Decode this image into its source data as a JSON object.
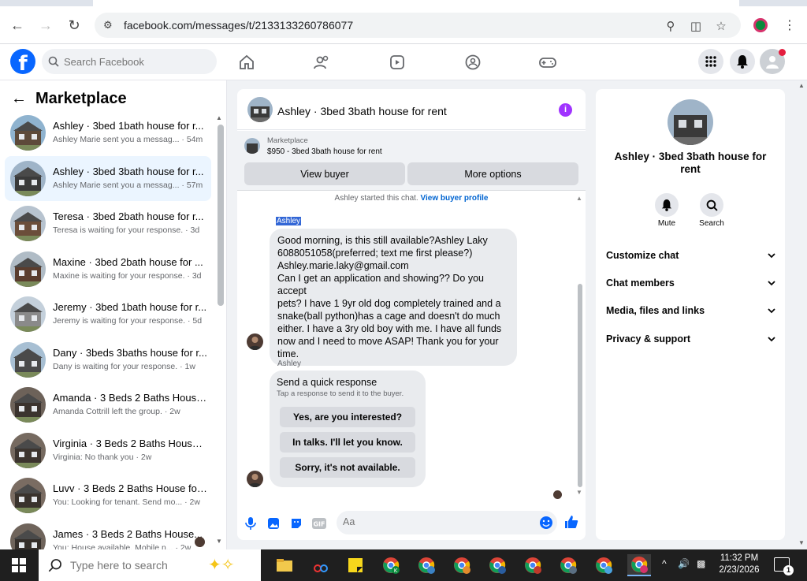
{
  "browser": {
    "url": "facebook.com/messages/t/2133133260786077"
  },
  "fb": {
    "search_placeholder": "Search Facebook",
    "logo": "f"
  },
  "left": {
    "title": "Marketplace",
    "conversations": [
      {
        "title": "Ashley · 3bed 1bath house for r...",
        "sub": "Ashley Marie sent you a messag... · 54m",
        "active": false
      },
      {
        "title": "Ashley · 3bed 3bath house for r...",
        "sub": "Ashley Marie sent you a messag... · 57m",
        "active": true
      },
      {
        "title": "Teresa · 3bed 2bath house for r...",
        "sub": "Teresa is waiting for your response. · 3d",
        "active": false
      },
      {
        "title": "Maxine · 3bed 2bath house for ...",
        "sub": "Maxine is waiting for your response. · 3d",
        "active": false
      },
      {
        "title": "Jeremy · 3bed 1bath house for r...",
        "sub": "Jeremy is waiting for your response. · 5d",
        "active": false
      },
      {
        "title": "Dany · 3beds 3baths house for r...",
        "sub": "Dany is waiting for your response. · 1w",
        "active": false
      },
      {
        "title": "Amanda · 3 Beds 2 Baths House...",
        "sub": "Amanda Cottrill left the group. · 2w",
        "active": false
      },
      {
        "title": "Virginia · 3 Beds 2 Baths House ...",
        "sub": "Virginia: No thank you · 2w",
        "active": false
      },
      {
        "title": "Luvv · 3 Beds 2 Baths House for...",
        "sub": "You: Looking for tenant. Send mo... · 2w",
        "active": false
      },
      {
        "title": "James · 3 Beds 2 Baths House...",
        "sub": "You: House available. Mobile n... · 2w",
        "active": false
      }
    ]
  },
  "chat": {
    "title": "Ashley · 3bed 3bath house for rent",
    "marketplace_label": "Marketplace",
    "listing": "$950 - 3bed 3bath house for rent",
    "view_buyer": "View buyer",
    "more_options": "More options",
    "notice": "Ashley started this chat.",
    "notice_link": "View buyer profile",
    "sender1": "Ashley",
    "message_lines": [
      "Good morning, is this still available?Ashley Laky",
      "6088051058(preferred; text me first please?)",
      "Ashley.marie.laky@gmail.com",
      "Can I get an application and showing?? Do you accept",
      "pets? I have 1 9yr old dog completely trained and a",
      "snake(ball python)has a cage and doesn't do much",
      "either. I have a 3ry old boy with me. I have all funds",
      "now and I need to move ASAP! Thank you for your",
      "time."
    ],
    "sender2": "Ashley",
    "quick_title": "Send a quick response",
    "quick_sub": "Tap a response to send it to the buyer.",
    "quick_options": [
      "Yes, are you interested?",
      "In talks. I'll let you know.",
      "Sorry, it's not available."
    ],
    "composer_placeholder": "Aa"
  },
  "right": {
    "title": "Ashley · 3bed 3bath house for rent",
    "mute": "Mute",
    "search": "Search",
    "sections": [
      "Customize chat",
      "Chat members",
      "Media, files and links",
      "Privacy & support"
    ]
  },
  "taskbar": {
    "search_placeholder": "Type here to search",
    "time": "11:32 PM",
    "date": "2/23/2026",
    "notif_count": "1"
  },
  "colors": {
    "fb_blue": "#0866ff",
    "messenger_purple": "#a033ff",
    "active_row": "#ebf5ff"
  }
}
